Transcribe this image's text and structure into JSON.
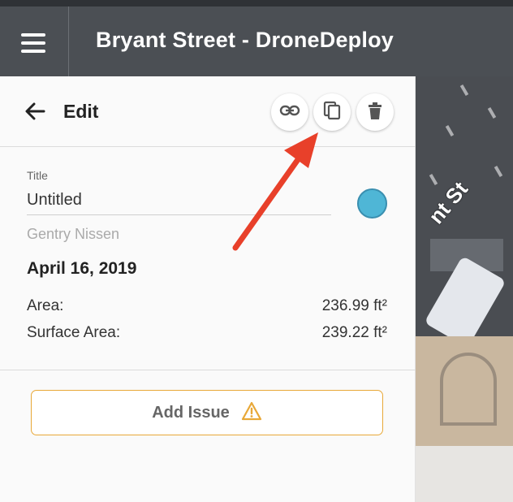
{
  "header": {
    "title": "Bryant Street - DroneDeploy"
  },
  "map": {
    "street_label": "nt St"
  },
  "panel": {
    "heading": "Edit",
    "actions": {
      "link_icon": "link-icon",
      "copy_icon": "copy-icon",
      "delete_icon": "trash-icon"
    },
    "title_label": "Title",
    "title_value": "Untitled",
    "color": "#4fb6d6",
    "author": "Gentry Nissen",
    "date": "April 16, 2019",
    "measurements": [
      {
        "label": "Area:",
        "value": "236.99 ft²"
      },
      {
        "label": "Surface Area:",
        "value": "239.22 ft²"
      }
    ],
    "add_issue_label": "Add Issue",
    "add_issue_icon": "warning-icon"
  },
  "colors": {
    "header_bg": "#4b4f54",
    "accent_orange": "#e8a838",
    "annotation_arrow": "#e8402a"
  }
}
